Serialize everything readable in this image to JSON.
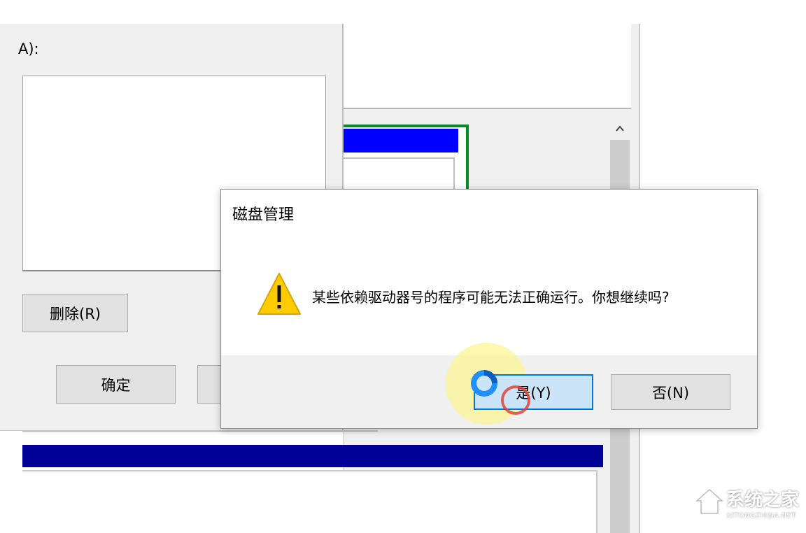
{
  "background_window": {
    "label_fragment": "A):",
    "delete_button": "删除(R)",
    "ok_button": "确定"
  },
  "dialog": {
    "title": "磁盘管理",
    "message": "某些依赖驱动器号的程序可能无法正确运行。你想继续吗?",
    "yes_button": "是(Y)",
    "no_button": "否(N)",
    "warning_icon": "warning-triangle-icon"
  },
  "watermark": {
    "text": "系统之家",
    "url": "XITONGZHIJIA.NET"
  },
  "colors": {
    "selection_blue": "#0000ff",
    "navy_bar": "#000099",
    "green_border": "#0b8a23",
    "highlight_yellow": "#fbf7a6",
    "cursor_blue": "#1e90ff",
    "click_red": "#e0443a"
  }
}
